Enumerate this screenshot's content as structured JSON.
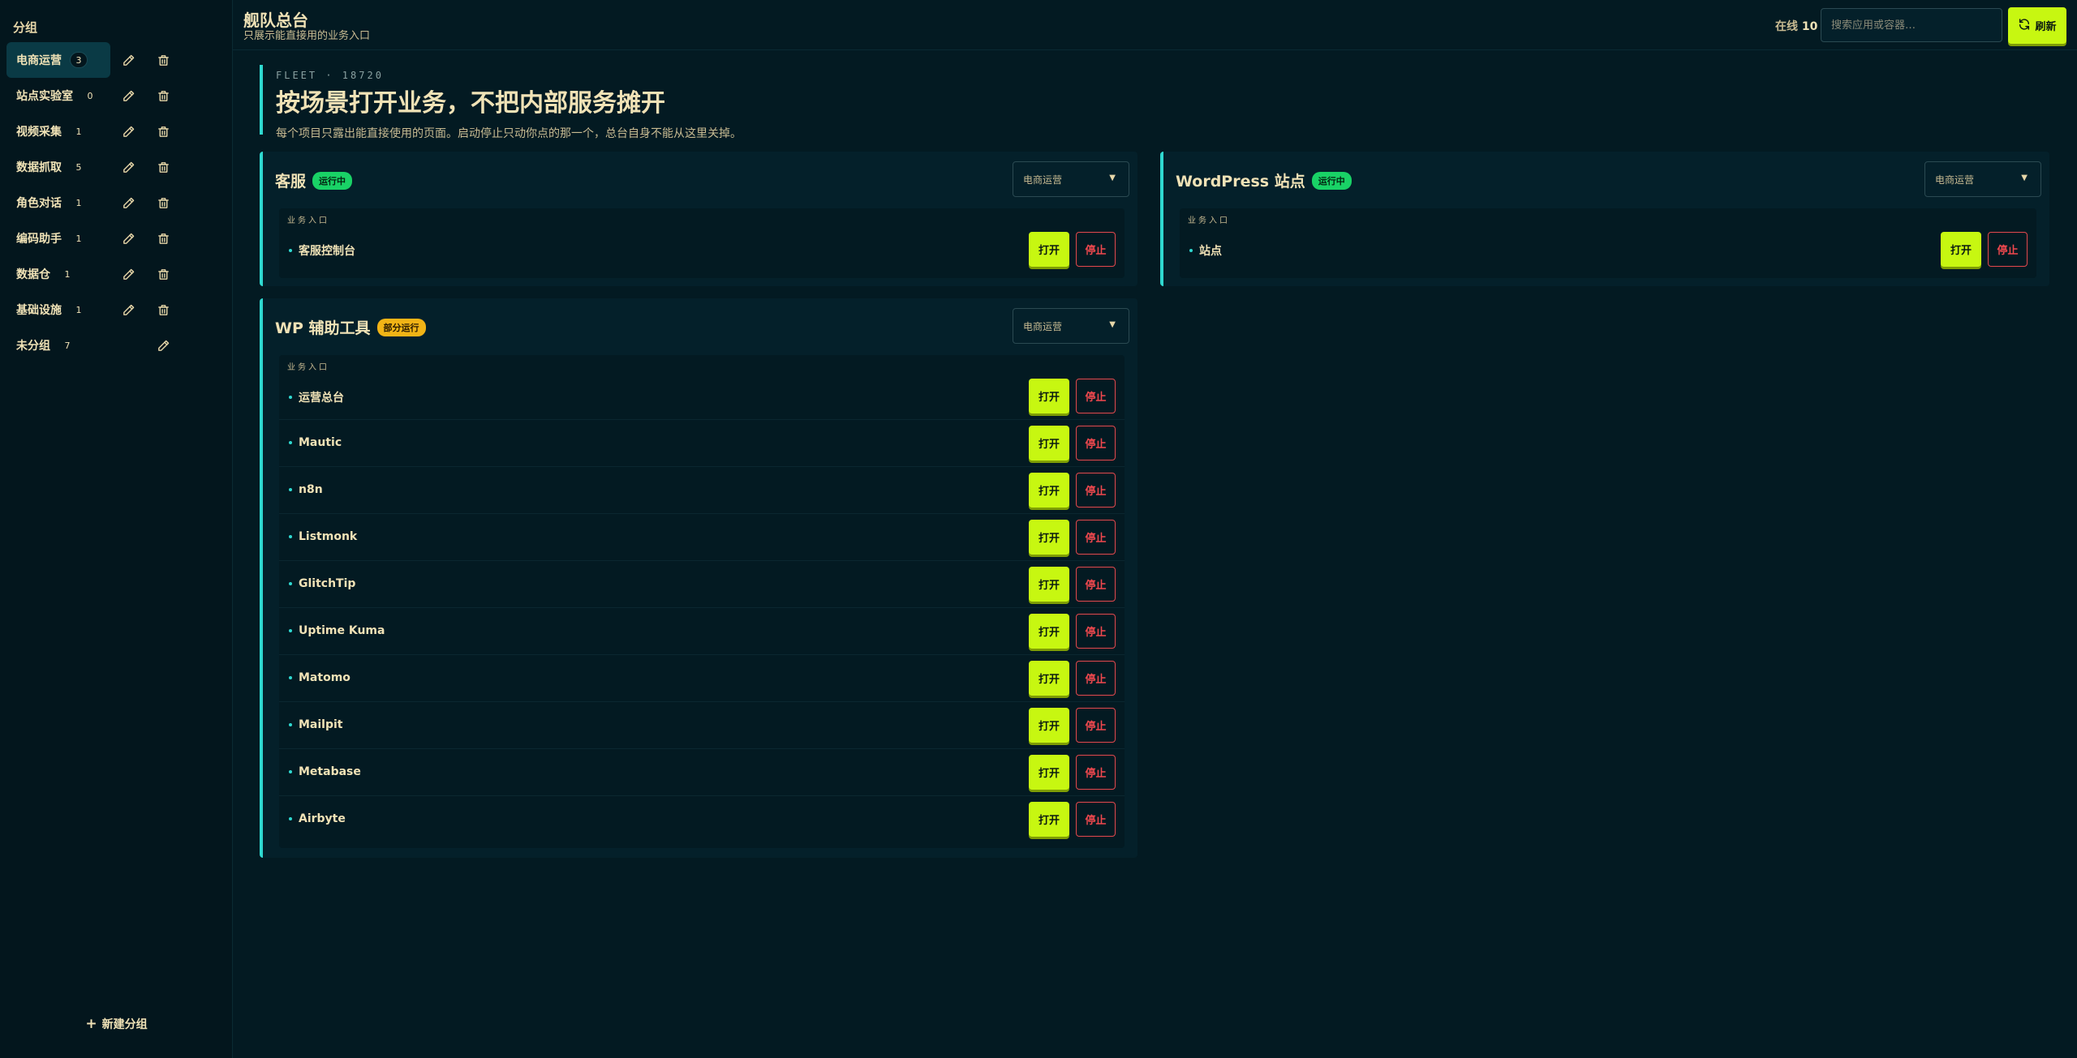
{
  "sidebar": {
    "title": "分组",
    "groups": [
      {
        "name": "电商运营",
        "count": "3",
        "active": true,
        "deletable": true
      },
      {
        "name": "站点实验室",
        "count": "0",
        "active": false,
        "deletable": true
      },
      {
        "name": "视频采集",
        "count": "1",
        "active": false,
        "deletable": true
      },
      {
        "name": "数据抓取",
        "count": "5",
        "active": false,
        "deletable": true
      },
      {
        "name": "角色对话",
        "count": "1",
        "active": false,
        "deletable": true
      },
      {
        "name": "编码助手",
        "count": "1",
        "active": false,
        "deletable": true
      },
      {
        "name": "数据仓",
        "count": "1",
        "active": false,
        "deletable": true
      },
      {
        "name": "基础设施",
        "count": "1",
        "active": false,
        "deletable": true
      },
      {
        "name": "未分组",
        "count": "7",
        "active": false,
        "deletable": false
      }
    ],
    "new_group_label": "新建分组",
    "icons": {
      "edit": "pencil-icon",
      "delete": "trash-icon",
      "add": "plus-icon"
    }
  },
  "header": {
    "title": "舰队总台",
    "subtitle": "只展示能直接用的业务入口",
    "online_label": "在线",
    "online_count": "10",
    "search_placeholder": "搜索应用或容器…",
    "refresh_label": "刷新"
  },
  "hero": {
    "eyebrow": "FLEET · 18720",
    "title": "按场景打开业务，不把内部服务摊开",
    "description": "每个项目只露出能直接使用的页面。启动停止只动你点的那一个，总台自身不能从这里关掉。"
  },
  "common": {
    "entries_label": "业务入口",
    "open_label": "打开",
    "stop_label": "停止"
  },
  "cards": [
    {
      "title": "客服",
      "status": "运行中",
      "status_kind": "running",
      "group": "电商运营",
      "entries": [
        "客服控制台"
      ]
    },
    {
      "title": "WordPress 站点",
      "status": "运行中",
      "status_kind": "running",
      "group": "电商运营",
      "entries": [
        "站点"
      ]
    },
    {
      "title": "WP 辅助工具",
      "status": "部分运行",
      "status_kind": "partial",
      "group": "电商运营",
      "entries": [
        "运营总台",
        "Mautic",
        "n8n",
        "Listmonk",
        "GlitchTip",
        "Uptime Kuma",
        "Matomo",
        "Mailpit",
        "Metabase",
        "Airbyte"
      ]
    }
  ],
  "colors": {
    "background": "#031a22",
    "accent_lime": "#c7f711",
    "accent_cyan": "#2fd9d0",
    "running_green": "#19d266",
    "partial_amber": "#f2b416",
    "stop_red": "#e5484d"
  }
}
